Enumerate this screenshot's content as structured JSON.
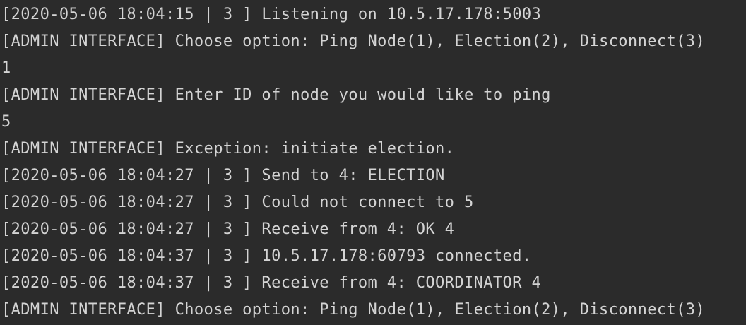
{
  "console": {
    "lines": [
      "[2020-05-06 18:04:15 | 3 ] Listening on 10.5.17.178:5003",
      "[ADMIN INTERFACE] Choose option: Ping Node(1), Election(2), Disconnect(3)",
      "1",
      "[ADMIN INTERFACE] Enter ID of node you would like to ping",
      "5",
      "[ADMIN INTERFACE] Exception: initiate election.",
      "[2020-05-06 18:04:27 | 3 ] Send to 4: ELECTION",
      "[2020-05-06 18:04:27 | 3 ] Could not connect to 5",
      "[2020-05-06 18:04:27 | 3 ] Receive from 4: OK 4",
      "[2020-05-06 18:04:37 | 3 ] 10.5.17.178:60793 connected.",
      "[2020-05-06 18:04:37 | 3 ] Receive from 4: COORDINATOR 4",
      "[ADMIN INTERFACE] Choose option: Ping Node(1), Election(2), Disconnect(3)"
    ]
  },
  "colors": {
    "background": "#2b2b2b",
    "text": "#d4d4d4"
  }
}
